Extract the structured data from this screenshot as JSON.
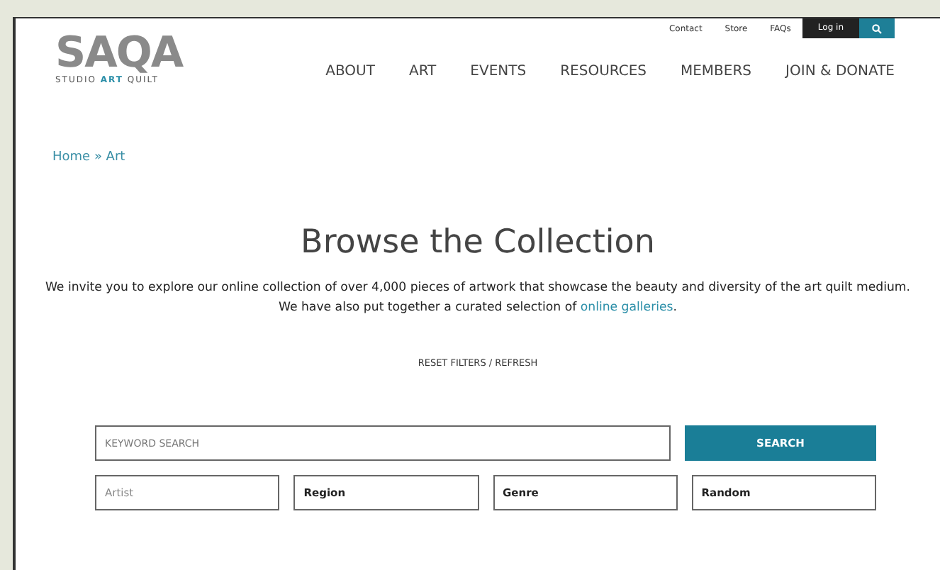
{
  "utility_links": [
    {
      "label": "Contact",
      "kind": "link"
    },
    {
      "label": "Store",
      "kind": "link"
    },
    {
      "label": "FAQs",
      "kind": "link"
    },
    {
      "label": "Log in",
      "kind": "login"
    }
  ],
  "logo": {
    "name": "SAQA",
    "tagline_start": "STUDIO ",
    "tagline_bold": "ART",
    "tagline_end": " QUILT"
  },
  "nav": [
    "ABOUT",
    "ART",
    "EVENTS",
    "RESOURCES",
    "MEMBERS",
    "JOIN & DONATE"
  ],
  "breadcrumb": "Home » Art",
  "title": "Browse the Collection",
  "intro": {
    "text": "We invite you to explore our online collection of over 4,000 pieces of artwork that showcase the beauty and diversity of the art quilt medium. We have also put together a curated selection of ",
    "link": "online galleries",
    "end": "."
  },
  "reset": "RESET FILTERS / REFRESH",
  "search": {
    "placeholder": "KEYWORD SEARCH",
    "button": "SEARCH"
  },
  "filters": [
    {
      "placeholder": "Artist"
    },
    {
      "value": "Region"
    },
    {
      "value": "Genre"
    },
    {
      "value": "Random"
    }
  ]
}
